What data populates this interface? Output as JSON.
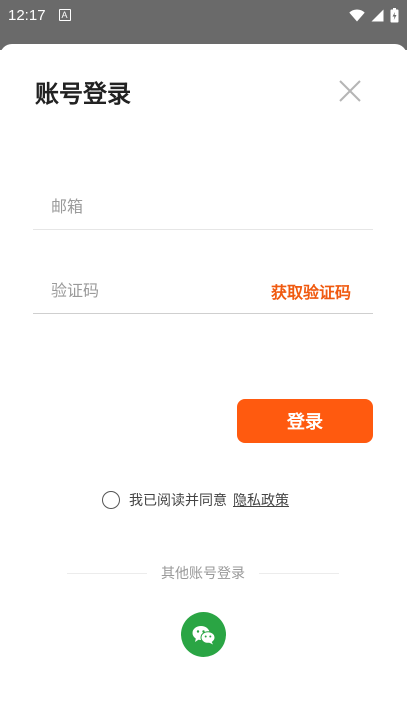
{
  "status_bar": {
    "time": "12:17",
    "notification_letter": "A"
  },
  "sheet": {
    "title": "账号登录"
  },
  "email": {
    "placeholder": "邮箱",
    "value": ""
  },
  "code": {
    "placeholder": "验证码",
    "value": "",
    "get_code_label": "获取验证码"
  },
  "login": {
    "label": "登录"
  },
  "agreement": {
    "text": "我已阅读并同意",
    "link": "隐私政策",
    "checked": false
  },
  "other_login": {
    "label": "其他账号登录"
  },
  "colors": {
    "accent": "#ff5a0f",
    "accent_text": "#f05a10",
    "wechat": "#2aa544",
    "dim_overlay": "#6a6a6a"
  },
  "icons": [
    "close-icon",
    "wechat-icon",
    "wifi-icon",
    "signal-icon",
    "battery-icon"
  ]
}
